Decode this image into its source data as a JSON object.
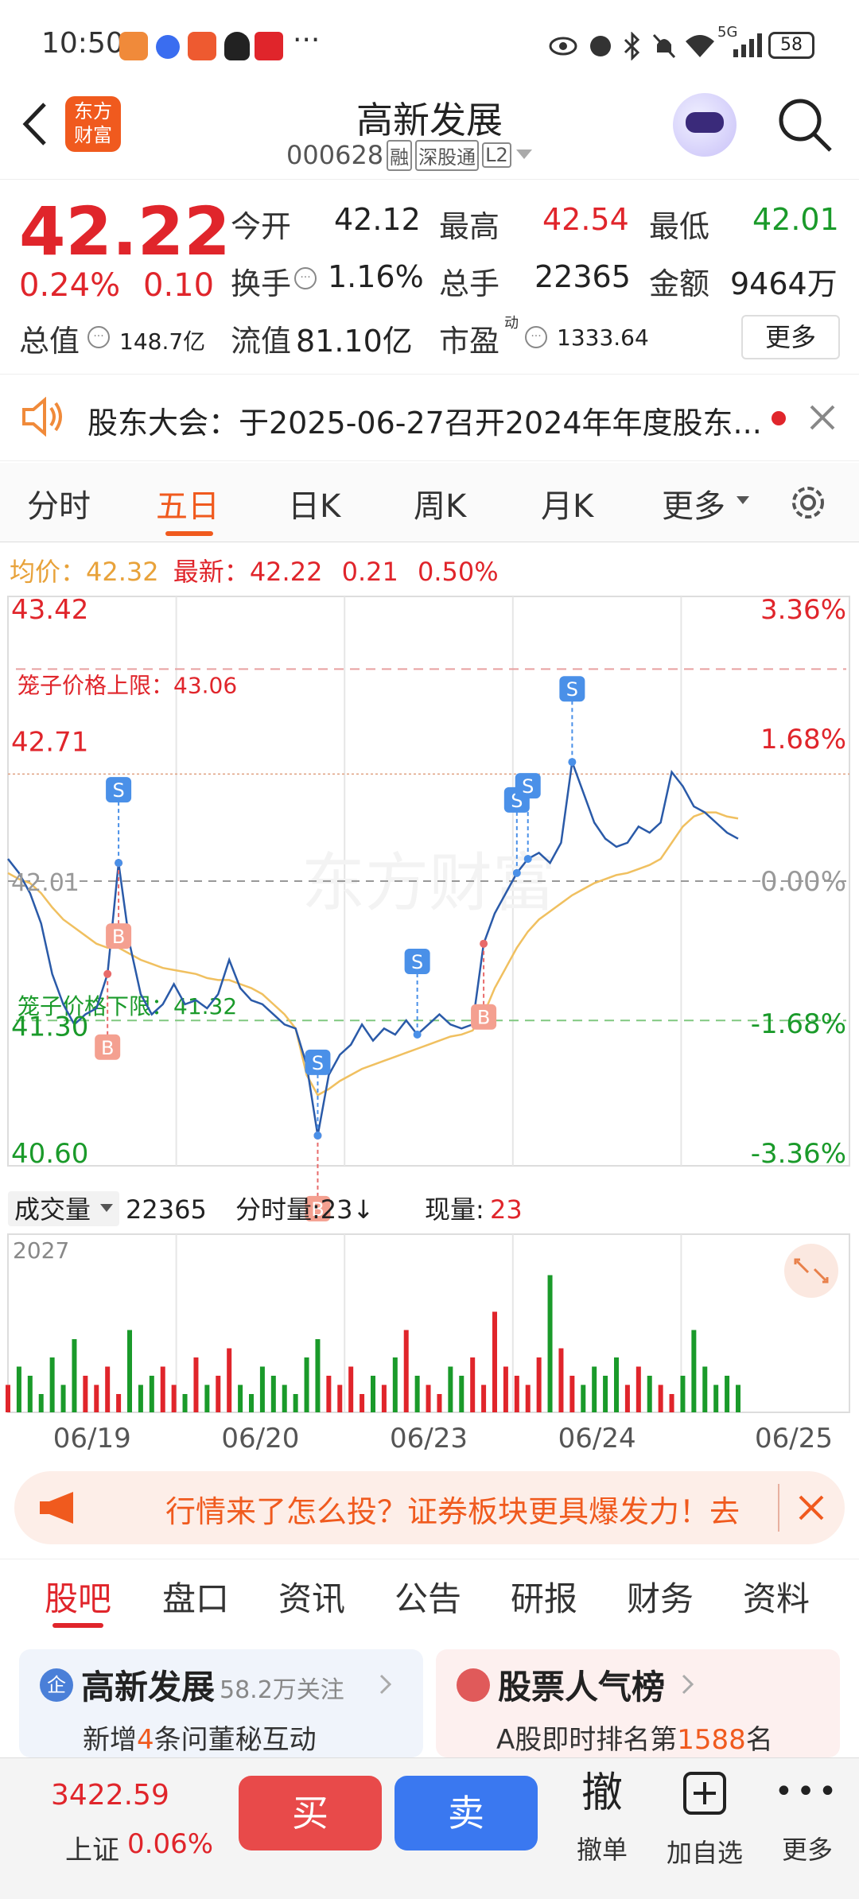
{
  "status": {
    "time": "10:50",
    "dots": "···",
    "battery": "58",
    "network": "5G"
  },
  "header": {
    "title": "高新发展",
    "code": "000628",
    "tags": [
      "融",
      "深股通",
      "L2"
    ],
    "logo_text": "东方\n财富"
  },
  "quote": {
    "price": "42.22",
    "pct": "0.24%",
    "chg": "0.10",
    "open_label": "今开",
    "open": "42.12",
    "high_label": "最高",
    "high": "42.54",
    "low_label": "最低",
    "low": "42.01",
    "turnover_label": "换手",
    "turnover": "1.16%",
    "volume_label": "总手",
    "volume": "22365",
    "amount_label": "金额",
    "amount": "9464万",
    "mktcap_label": "总值",
    "mktcap": "148.7亿",
    "float_label": "流值",
    "float": "81.10亿",
    "pe_label": "市盈",
    "pe_sup": "动",
    "pe": "1333.64",
    "more": "更多"
  },
  "notice": {
    "text": "股东大会：于2025-06-27召开2024年年度股东..."
  },
  "tabs": {
    "items": [
      "分时",
      "五日",
      "日K",
      "周K",
      "月K",
      "更多"
    ],
    "active": 1
  },
  "legend": {
    "avg_label": "均价：",
    "avg": "42.32",
    "last_label": "最新：",
    "last": "42.22",
    "chg": "0.21",
    "pct": "0.50%"
  },
  "chart_data": {
    "type": "line",
    "title": "",
    "ylim": [
      40.6,
      43.42
    ],
    "y_left_ticks": [
      "43.42",
      "42.71",
      "41.30",
      "40.60"
    ],
    "y_right_ticks": [
      "3.36%",
      "1.68%",
      "0.00%",
      "-1.68%",
      "-3.36%"
    ],
    "y_center": "42.01",
    "cage_upper_label": "笼子价格上限：43.06",
    "cage_lower_label": "笼子价格下限：41.32",
    "x_ticks": [
      "06/19",
      "06/20",
      "06/23",
      "06/24",
      "06/25"
    ],
    "watermark": "东方财富",
    "series": [
      {
        "values": [
          42.12,
          42.05,
          41.95,
          41.8,
          41.55,
          41.4,
          41.3,
          41.35,
          41.38,
          41.55,
          42.1,
          41.7,
          41.45,
          41.35,
          41.4,
          41.5,
          41.4,
          41.42,
          41.38,
          41.45,
          41.62,
          41.48,
          41.42,
          41.4,
          41.35,
          41.3,
          41.28,
          41.1,
          40.75,
          41.05,
          41.15,
          41.2,
          41.3,
          41.22,
          41.28,
          41.25,
          41.32,
          41.25,
          41.3,
          41.35,
          41.3,
          41.28,
          41.3,
          41.7,
          41.85,
          41.95,
          42.05,
          42.12,
          42.15,
          42.1,
          42.2,
          42.6,
          42.45,
          42.3,
          42.22,
          42.18,
          42.2,
          42.28,
          42.25,
          42.3,
          42.55,
          42.48,
          42.38,
          42.35,
          42.3,
          42.25,
          42.22
        ]
      },
      {
        "name": "均价",
        "values": [
          42.05,
          42.02,
          42.0,
          41.95,
          41.88,
          41.82,
          41.78,
          41.74,
          41.7,
          41.68,
          41.68,
          41.65,
          41.62,
          41.6,
          41.58,
          41.57,
          41.56,
          41.55,
          41.53,
          41.52,
          41.52,
          41.5,
          41.48,
          41.45,
          41.4,
          41.35,
          41.28,
          41.05,
          40.95,
          40.98,
          41.02,
          41.05,
          41.08,
          41.1,
          41.12,
          41.14,
          41.16,
          41.18,
          41.2,
          41.22,
          41.24,
          41.25,
          41.27,
          41.35,
          41.48,
          41.58,
          41.68,
          41.76,
          41.82,
          41.86,
          41.9,
          41.94,
          41.97,
          42.0,
          42.02,
          42.04,
          42.05,
          42.07,
          42.09,
          42.12,
          42.2,
          42.28,
          42.33,
          42.35,
          42.35,
          42.33,
          42.32
        ]
      }
    ],
    "signals": [
      {
        "type": "B",
        "i": 9
      },
      {
        "type": "B",
        "i": 10
      },
      {
        "type": "S",
        "i": 10
      },
      {
        "type": "B",
        "i": 28
      },
      {
        "type": "S",
        "i": 28
      },
      {
        "type": "S",
        "i": 37
      },
      {
        "type": "B",
        "i": 43
      },
      {
        "type": "S",
        "i": 46
      },
      {
        "type": "S",
        "i": 47
      },
      {
        "type": "S",
        "i": 51
      }
    ]
  },
  "volume": {
    "label": "成交量",
    "total": "22365",
    "tick_label": "分时量:23↓",
    "now_label": "现量:",
    "now": "23",
    "ymax": "2027",
    "bars": [
      3,
      5,
      4,
      2,
      6,
      3,
      8,
      4,
      3,
      5,
      2,
      9,
      3,
      4,
      5,
      3,
      2,
      6,
      3,
      4,
      7,
      3,
      2,
      5,
      4,
      3,
      2,
      6,
      8,
      4,
      3,
      5,
      2,
      4,
      3,
      6,
      9,
      4,
      3,
      2,
      5,
      4,
      6,
      3,
      11,
      5,
      4,
      3,
      6,
      15,
      7,
      4,
      3,
      5,
      4,
      6,
      3,
      5,
      4,
      3,
      2,
      4,
      9,
      5,
      3,
      4,
      3
    ]
  },
  "banner": {
    "text": "行情来了怎么投？证券板块更具爆发力！去"
  },
  "sections": {
    "items": [
      "股吧",
      "盘口",
      "资讯",
      "公告",
      "研报",
      "财务",
      "资料"
    ],
    "active": 0
  },
  "cards": [
    {
      "title": "高新发展",
      "sub": "58.2万关注",
      "line_prefix": "新增",
      "line_num": "4",
      "line_suffix": "条问董秘互动"
    },
    {
      "title": "股票人气榜",
      "line_prefix": "A股即时排名第",
      "line_num": "1588",
      "line_suffix": "名"
    }
  ],
  "bottom": {
    "index_value": "3422.59",
    "index_name": "上证",
    "index_pct": "0.06%",
    "buy": "买",
    "sell": "卖",
    "cancel_big": "撤",
    "cancel": "撤单",
    "add": "加自选",
    "more": "更多"
  }
}
